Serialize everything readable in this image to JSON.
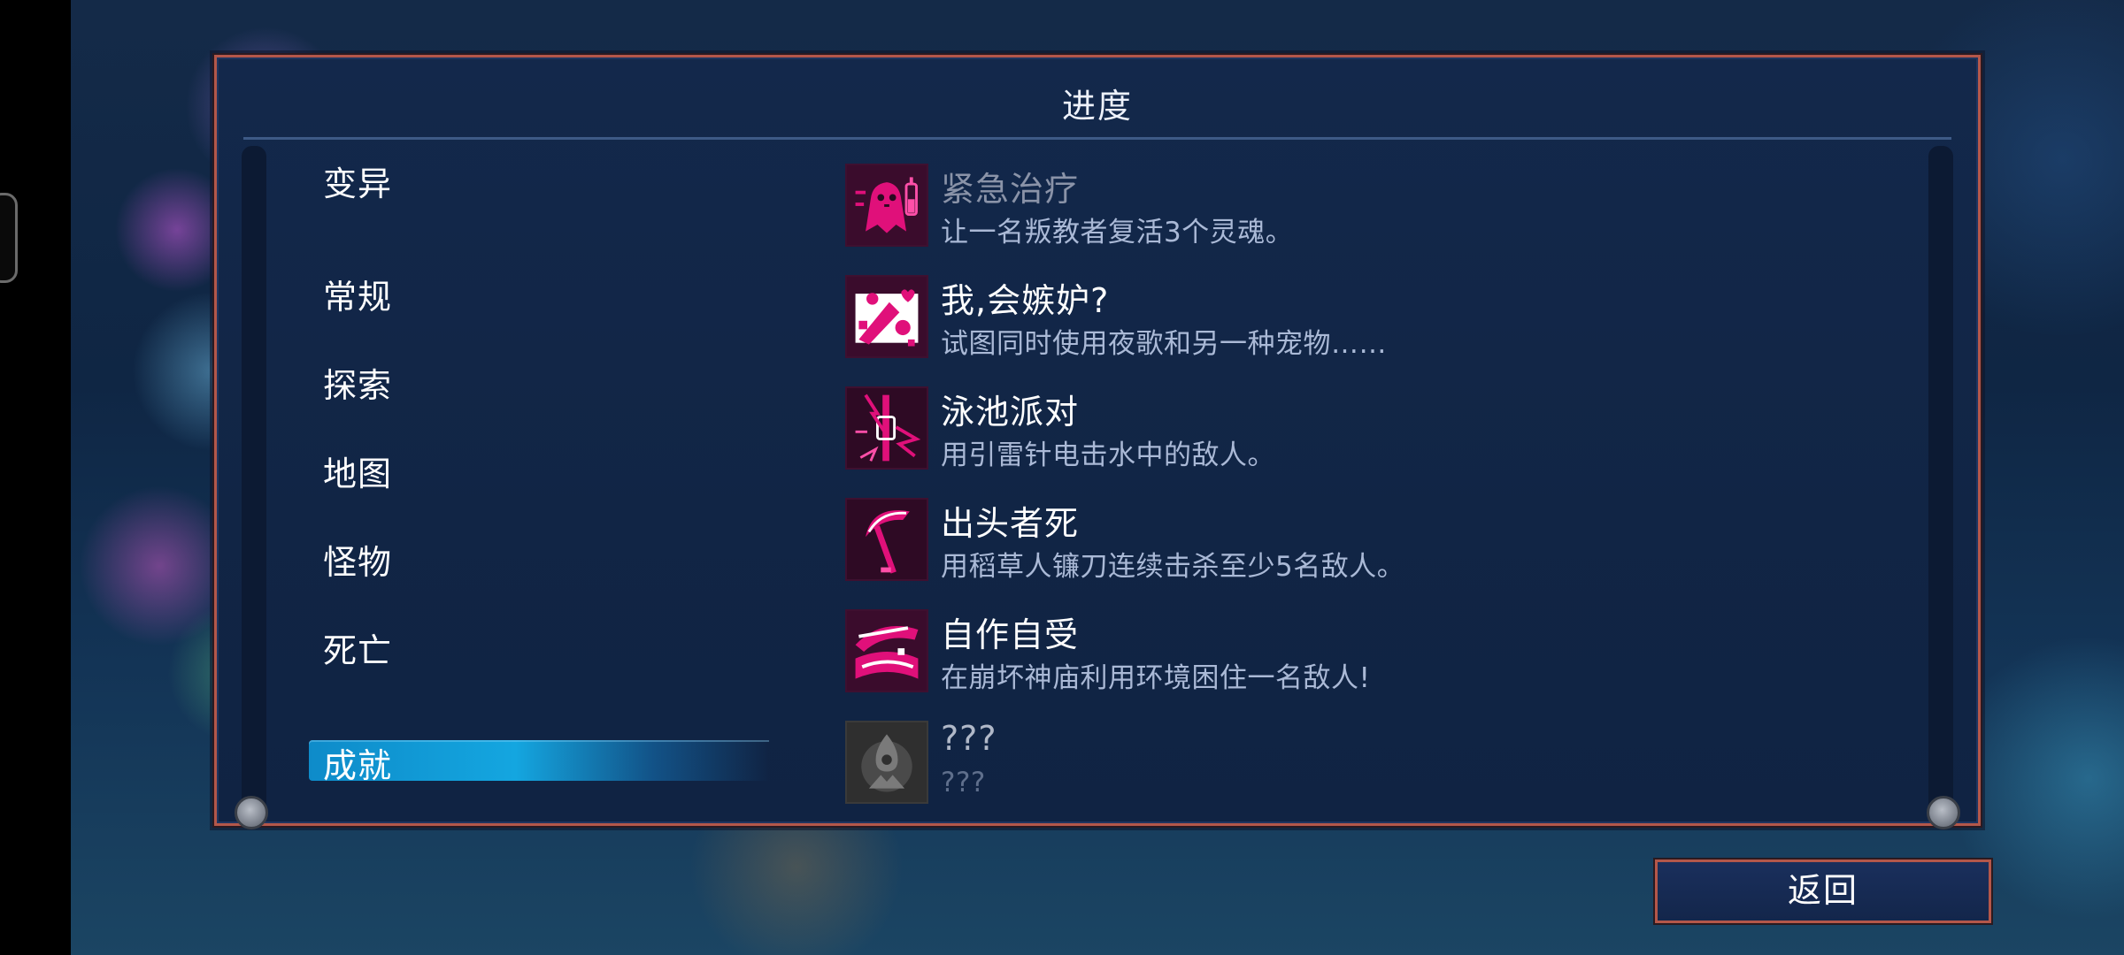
{
  "panel": {
    "title": "进度"
  },
  "categories": [
    {
      "label": "变异"
    },
    {
      "label": "常规"
    },
    {
      "label": "探索"
    },
    {
      "label": "地图"
    },
    {
      "label": "怪物"
    },
    {
      "label": "死亡"
    },
    {
      "label": "成就",
      "selected": true
    }
  ],
  "achievements": [
    {
      "name": "紧急治疗",
      "description": "让一名叛教者复活3个灵魂。",
      "icon": "ghost-syringe-icon",
      "state": "partially-visible"
    },
    {
      "name": "我,会嫉妒?",
      "description": "试图同时使用夜歌和另一种宠物……",
      "icon": "pets-heart-icon",
      "state": "unlocked"
    },
    {
      "name": "泳池派对",
      "description": "用引雷针电击水中的敌人。",
      "icon": "lightning-rod-icon",
      "state": "unlocked"
    },
    {
      "name": "出头者死",
      "description": "用稻草人镰刀连续击杀至少5名敌人。",
      "icon": "scythe-icon",
      "state": "unlocked"
    },
    {
      "name": "自作自受",
      "description": "在崩坏神庙利用环境困住一名敌人!",
      "icon": "trap-icon",
      "state": "unlocked"
    },
    {
      "name": "???",
      "description": "???",
      "icon": "locked-achievement-icon",
      "state": "locked"
    }
  ],
  "back_button": {
    "label": "返回"
  },
  "colors": {
    "panel_border": "#b4574a",
    "panel_bg": "#13284b",
    "selected_tab": "#14a6e0",
    "icon_accent": "#e0107a",
    "description_text": "#aab9d6"
  }
}
